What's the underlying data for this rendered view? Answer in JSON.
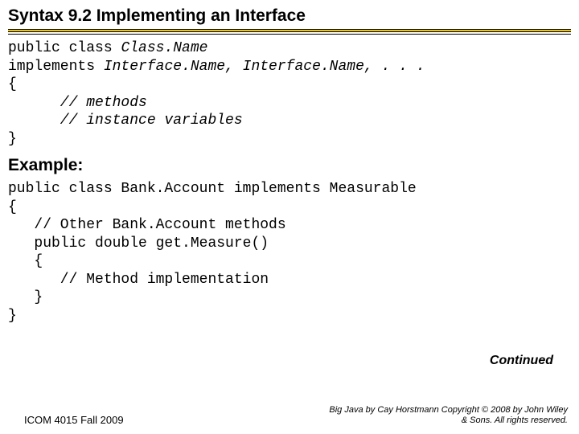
{
  "title": "Syntax 9.2 Implementing an Interface",
  "code1_l1a": "public class ",
  "code1_l1b": "Class.Name",
  "code1_l2a": "implements ",
  "code1_l2b": "Interface.Name, Interface.Name, . . .",
  "code1_l3": "{",
  "code1_l4": "      // methods",
  "code1_l5": "      // instance variables",
  "code1_l6": "}",
  "example_heading": "Example:",
  "code2_l1": "public class Bank.Account implements Measurable",
  "code2_l2": "{",
  "code2_l3": "   // Other Bank.Account methods",
  "code2_l4": "   public double get.Measure()",
  "code2_l5": "   {",
  "code2_l6": "      // Method implementation",
  "code2_l7": "   }",
  "code2_l8": "}",
  "continued": "Continued",
  "footer_left": "ICOM 4015 Fall 2009",
  "footer_right": "Big Java by Cay Horstmann Copyright © 2008 by John Wiley & Sons. All rights reserved."
}
